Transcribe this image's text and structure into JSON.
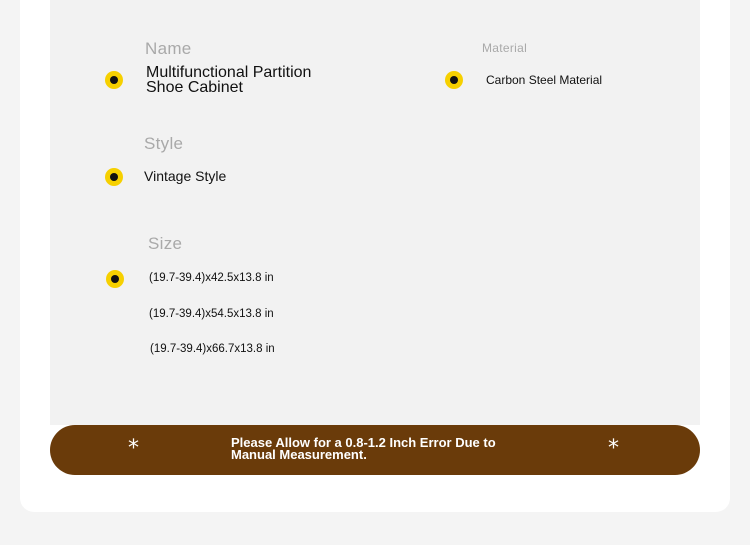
{
  "fields": {
    "name": {
      "label": "Name",
      "value": "Multifunctional Partition Shoe Cabinet"
    },
    "material": {
      "label": "Material",
      "value": "Carbon Steel Material"
    },
    "style": {
      "label": "Style",
      "value": "Vintage Style"
    },
    "size": {
      "label": "Size",
      "options": [
        "(19.7-39.4)x42.5x13.8 in",
        "(19.7-39.4)x54.5x13.8 in",
        "(19.7-39.4)x66.7x13.8 in"
      ]
    }
  },
  "banner": {
    "star_left": "*",
    "star_right": "*",
    "text": "Please Allow for a 0.8-1.2 Inch Error Due to Manual Measurement."
  },
  "colors": {
    "accent_dot": "#f6d000",
    "banner_background": "#6a3b0a",
    "label_gray": "#a9a9a9"
  }
}
